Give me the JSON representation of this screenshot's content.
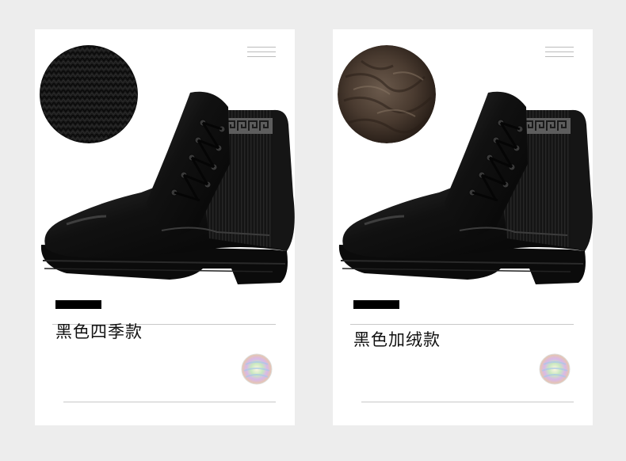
{
  "products": [
    {
      "variant_label": "黑色四季款",
      "swatch_material": "knit",
      "swatch_color": "#161616"
    },
    {
      "variant_label": "黑色加绒款",
      "swatch_material": "plush-fur",
      "swatch_color": "#4a3b30"
    }
  ],
  "icons": {
    "menu": "menu-icon",
    "holographic_seal": "hologram-seal-icon"
  },
  "colors": {
    "page_background": "#ededed",
    "card_background": "#ffffff",
    "boot_leather": "#121212",
    "label_bar": "#000000"
  }
}
